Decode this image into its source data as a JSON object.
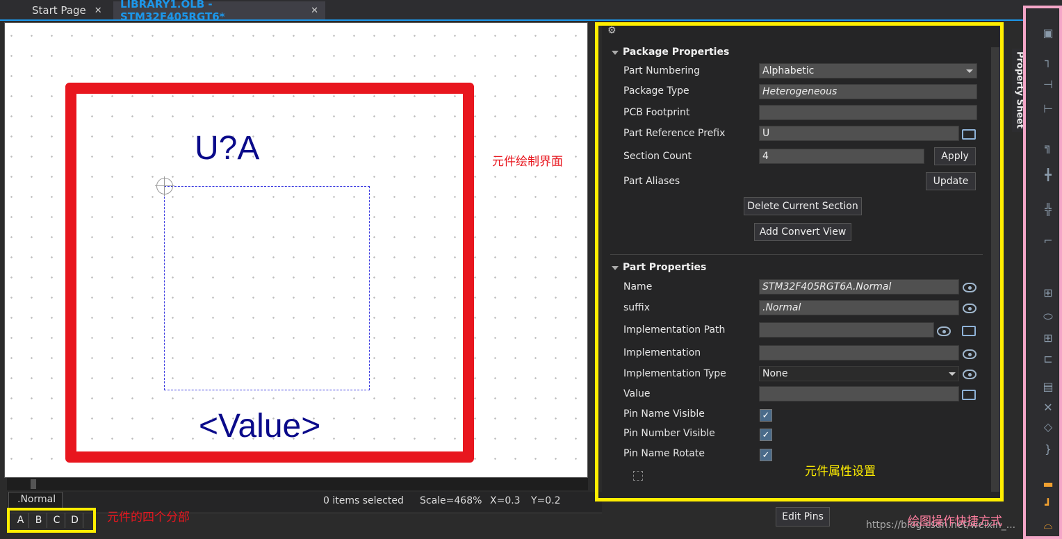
{
  "tabs": [
    {
      "label": "Start Page",
      "close": "✕"
    },
    {
      "label": "LIBRARY1.OLB - STM32F405RGT6*",
      "close": "✕"
    }
  ],
  "canvas": {
    "part_ref": "U?A",
    "value_text": "<Value>",
    "annotation": "元件绘制界面"
  },
  "status": {
    "view": ".Normal",
    "selection": "0 items selected",
    "scale": "Scale=468%",
    "x": "X=0.3",
    "y": "Y=0.2"
  },
  "sections": {
    "items": [
      "A",
      "B",
      "C",
      "D"
    ],
    "annotation": "元件的四个分部"
  },
  "package_properties": {
    "title": "Package Properties",
    "part_numbering": {
      "label": "Part Numbering",
      "value": "Alphabetic"
    },
    "package_type": {
      "label": "Package Type",
      "value": "Heterogeneous"
    },
    "pcb_footprint": {
      "label": "PCB Footprint",
      "value": ""
    },
    "part_ref_prefix": {
      "label": "Part Reference Prefix",
      "value": "U"
    },
    "section_count": {
      "label": "Section Count",
      "value": "4",
      "button": "Apply"
    },
    "part_aliases": {
      "label": "Part Aliases",
      "button": "Update"
    },
    "delete_section": "Delete Current Section",
    "add_convert": "Add Convert View"
  },
  "part_properties": {
    "title": "Part Properties",
    "name": {
      "label": "Name",
      "value": "STM32F405RGT6A.Normal"
    },
    "suffix": {
      "label": "suffix",
      "value": ".Normal"
    },
    "impl_path": {
      "label": "Implementation Path",
      "value": ""
    },
    "implementation": {
      "label": "Implementation",
      "value": ""
    },
    "impl_type": {
      "label": "Implementation Type",
      "value": "None"
    },
    "value": {
      "label": "Value",
      "value": ""
    },
    "pin_name_visible": {
      "label": "Pin Name Visible",
      "checked": true
    },
    "pin_number_visible": {
      "label": "Pin Number Visible",
      "checked": true
    },
    "pin_name_rotate": {
      "label": "Pin Name Rotate",
      "checked": true
    }
  },
  "props_annotation": "元件属性设置",
  "side_tab": "Property Sheet",
  "edit_pins": "Edit Pins",
  "tools_annotation": "绘图操作快捷方式",
  "watermark": "https://blog.csdn.net/weixin_...",
  "colors": {
    "accent": "#1c97ea",
    "canvas_frame": "#e8161e",
    "highlight": "#ffee00",
    "toolbar_frame": "#f4a6c8"
  }
}
